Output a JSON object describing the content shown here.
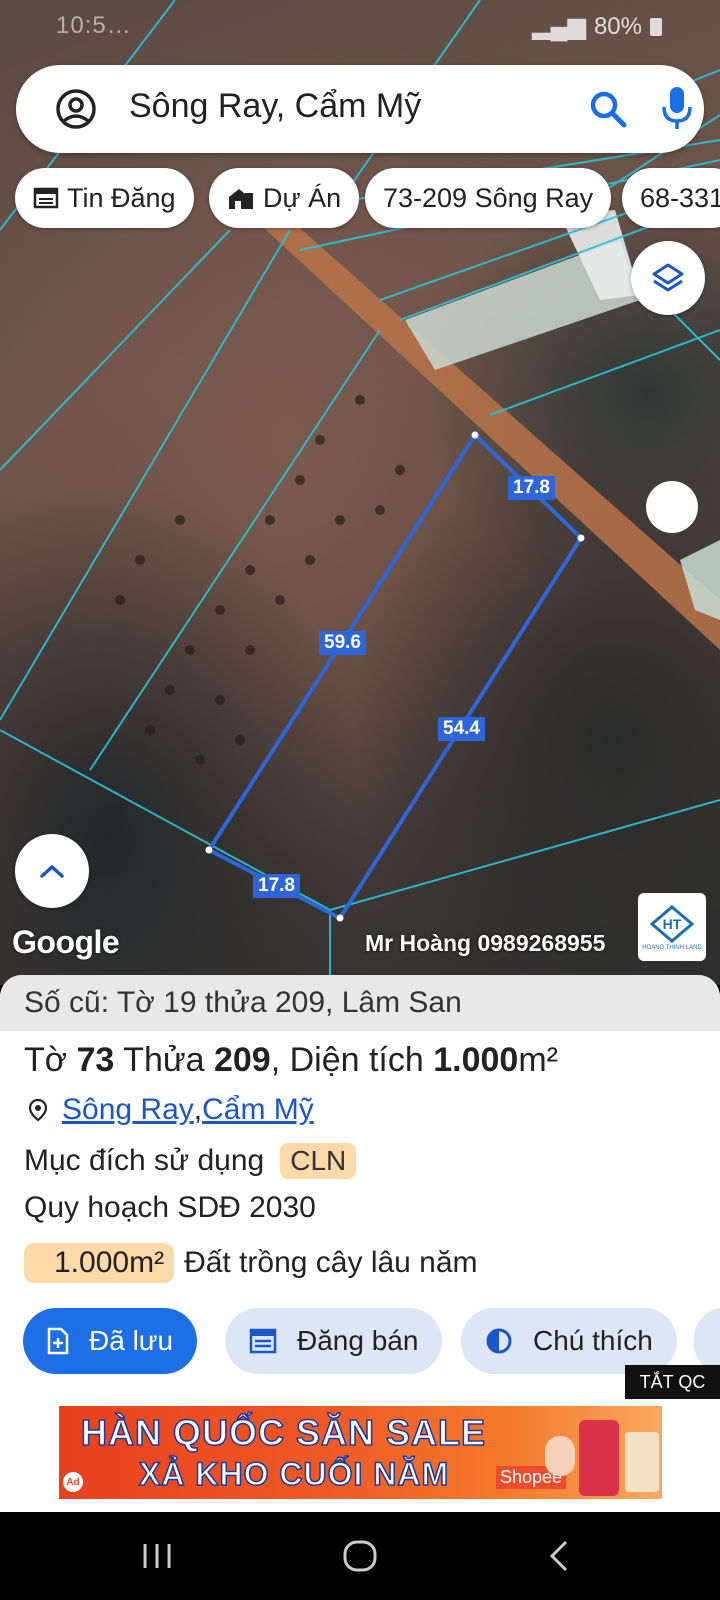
{
  "status_bar": {
    "time": "10:5…",
    "battery": "80%"
  },
  "search": {
    "query": "Sông Ray, Cẩm Mỹ"
  },
  "chips": [
    {
      "label": "Tin Đăng"
    },
    {
      "label": "Dự Án"
    },
    {
      "label": "73-209 Sông Ray"
    },
    {
      "label": "68-331"
    }
  ],
  "map": {
    "measurements": {
      "top": "17.8",
      "left": "59.6",
      "right": "54.4",
      "bottom": "17.8"
    },
    "provider": "Google",
    "watermark": "Mr Hoàng 0989268955",
    "watermark_logo_text": "HOANG THINH LAND",
    "colors": {
      "parcel_line": "#2e66d9",
      "grid_line": "#29c3d6",
      "road": "#b8734a"
    }
  },
  "sheet": {
    "old_info": "Số cũ: Tờ 19 thửa 209, Lâm San",
    "parcel": {
      "to_label": "Tờ ",
      "to_value": "73",
      "thua_label": " Thửa ",
      "thua_value": "209",
      "area_label": ", Diện tích ",
      "area_value": "1.000",
      "area_unit": "m²"
    },
    "location": {
      "commune": "Sông Ray",
      "sep": ", ",
      "district": "Cẩm Mỹ"
    },
    "purpose": {
      "label": "Mục đích sử dụng",
      "code": "CLN"
    },
    "plan": "Quy hoạch SDĐ 2030",
    "area_row": {
      "value": "1.000m²",
      "description": "Đất trồng cây lâu năm"
    },
    "actions": [
      {
        "label": "Đã lưu"
      },
      {
        "label": "Đăng bán"
      },
      {
        "label": "Chú thích"
      }
    ]
  },
  "ad": {
    "close_label": "TẮT QC",
    "line1": "HÀN QUỐC SĂN SALE",
    "line2": "XẢ KHO CUỐI NĂM",
    "brand": "Shopee",
    "badge": "Ad"
  }
}
